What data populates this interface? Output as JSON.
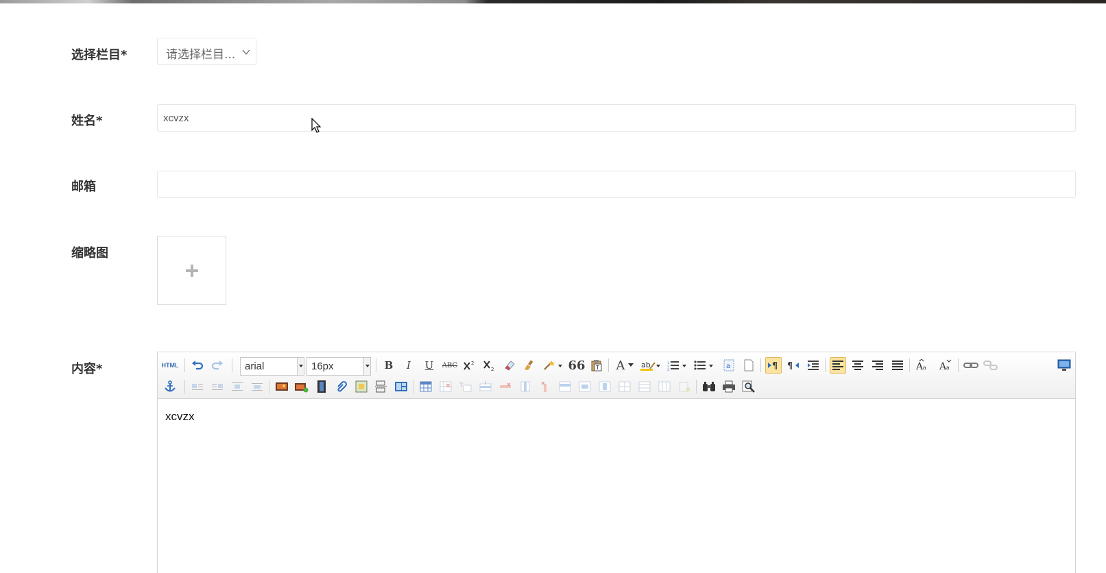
{
  "form": {
    "category": {
      "label": "选择栏目*",
      "value": "请选择栏目..."
    },
    "name": {
      "label": "姓名*",
      "value": "xcvzx"
    },
    "email": {
      "label": "邮箱",
      "value": ""
    },
    "thumbnail": {
      "label": "缩略图",
      "icon": "plus-icon"
    },
    "content": {
      "label": "内容*",
      "body": "xcvzx"
    }
  },
  "editor": {
    "font_family": "arial",
    "font_size": "16px",
    "html_label": "HTML",
    "bold": "B",
    "italic": "I",
    "underline": "U",
    "strike": "ABC",
    "quote": "66",
    "font_color": "A",
    "active_color": "#fbe3a0"
  }
}
